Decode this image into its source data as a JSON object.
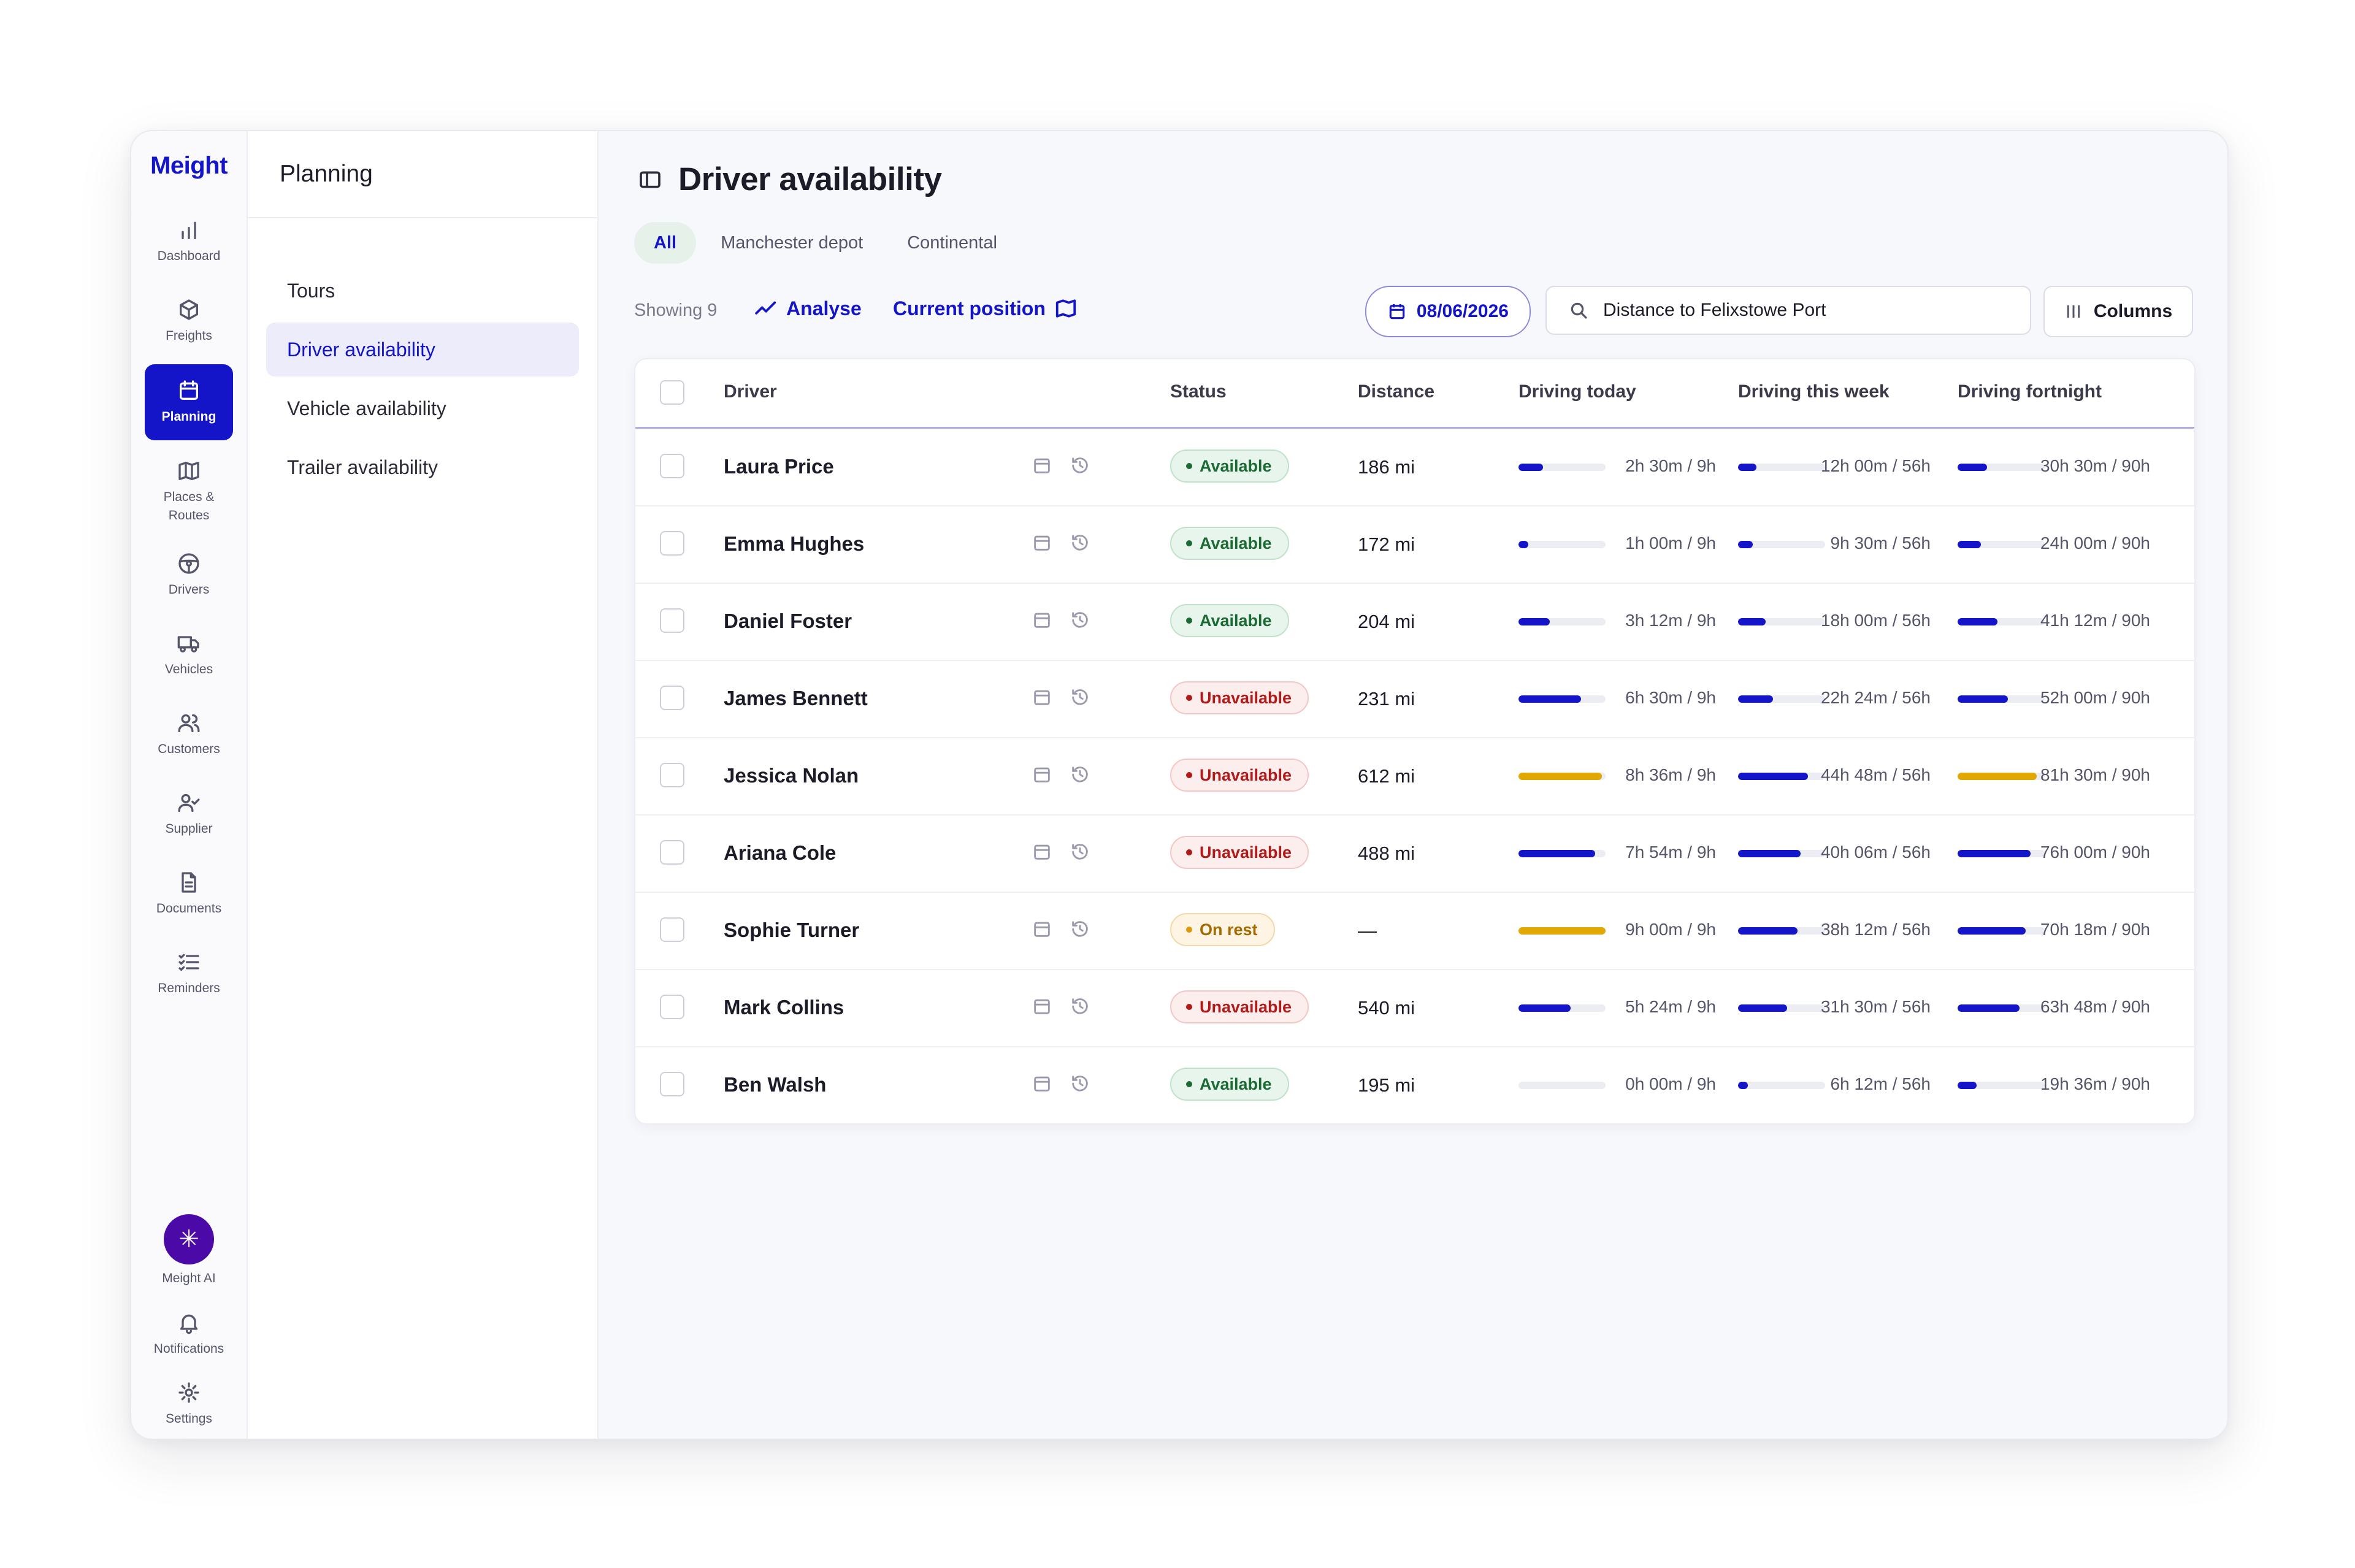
{
  "brand": "Meight",
  "rail": {
    "items": [
      {
        "label": "Dashboard",
        "icon": "bar-chart-icon"
      },
      {
        "label": "Freights",
        "icon": "box-icon"
      },
      {
        "label": "Planning",
        "icon": "calendar-icon",
        "active": true
      },
      {
        "label": "Places &\nRoutes",
        "icon": "map-icon"
      },
      {
        "label": "Drivers",
        "icon": "steering-wheel-icon"
      },
      {
        "label": "Vehicles",
        "icon": "truck-icon"
      },
      {
        "label": "Customers",
        "icon": "users-icon"
      },
      {
        "label": "Supplier",
        "icon": "user-check-icon"
      },
      {
        "label": "Documents",
        "icon": "document-icon"
      },
      {
        "label": "Reminders",
        "icon": "checklist-icon"
      }
    ],
    "bottom": {
      "ai_label": "Meight AI",
      "notifications_label": "Notifications",
      "settings_label": "Settings"
    }
  },
  "subnav": {
    "title": "Planning",
    "items": [
      {
        "label": "Tours"
      },
      {
        "label": "Driver availability",
        "active": true
      },
      {
        "label": "Vehicle availability"
      },
      {
        "label": "Trailer availability"
      }
    ]
  },
  "page": {
    "title": "Driver availability",
    "tabs": [
      "All",
      "Manchester depot",
      "Continental"
    ],
    "active_tab": "All",
    "showing": "Showing 9",
    "analyse_label": "Analyse",
    "position_label": "Current position",
    "date": "08/06/2026",
    "search_placeholder": "Distance to Felixstowe Port",
    "columns_label": "Columns"
  },
  "table": {
    "headers": {
      "driver": "Driver",
      "status": "Status",
      "distance": "Distance",
      "today": "Driving today",
      "week": "Driving this week",
      "fortnight": "Driving fortnight"
    },
    "rows": [
      {
        "driver": "Laura Price",
        "status": "Available",
        "state": "avail",
        "distance": "186 mi",
        "today": "2h 30m / 9h",
        "today_p": 0.28,
        "week": "12h 00m / 56h",
        "week_p": 0.21,
        "fort": "30h 30m / 90h",
        "fort_p": 0.34
      },
      {
        "driver": "Emma Hughes",
        "status": "Available",
        "state": "avail",
        "distance": "172 mi",
        "today": "1h 00m / 9h",
        "today_p": 0.11,
        "week": "9h 30m / 56h",
        "week_p": 0.17,
        "fort": "24h 00m / 90h",
        "fort_p": 0.27
      },
      {
        "driver": "Daniel Foster",
        "status": "Available",
        "state": "avail",
        "distance": "204 mi",
        "today": "3h 12m / 9h",
        "today_p": 0.36,
        "week": "18h 00m / 56h",
        "week_p": 0.32,
        "fort": "41h 12m / 90h",
        "fort_p": 0.46
      },
      {
        "driver": "James Bennett",
        "status": "Unavailable",
        "state": "unav",
        "distance": "231 mi",
        "today": "6h 30m / 9h",
        "today_p": 0.72,
        "week": "22h 24m / 56h",
        "week_p": 0.4,
        "fort": "52h 00m / 90h",
        "fort_p": 0.58
      },
      {
        "driver": "Jessica Nolan",
        "status": "Unavailable",
        "state": "unav",
        "distance": "612 mi",
        "today": "8h 36m / 9h",
        "today_p": 0.96,
        "today_warn": true,
        "week": "44h 48m / 56h",
        "week_p": 0.8,
        "fort": "81h 30m / 90h",
        "fort_p": 0.91,
        "fort_warn": true
      },
      {
        "driver": "Ariana Cole",
        "status": "Unavailable",
        "state": "unav",
        "distance": "488 mi",
        "today": "7h 54m / 9h",
        "today_p": 0.88,
        "week": "40h 06m / 56h",
        "week_p": 0.72,
        "fort": "76h 00m / 90h",
        "fort_p": 0.84
      },
      {
        "driver": "Sophie Turner",
        "status": "On rest",
        "state": "rest",
        "distance": "—",
        "today": "9h 00m / 9h",
        "today_p": 1.0,
        "today_warn": true,
        "week": "38h 12m / 56h",
        "week_p": 0.68,
        "fort": "70h 18m / 90h",
        "fort_p": 0.78
      },
      {
        "driver": "Mark Collins",
        "status": "Unavailable",
        "state": "unav",
        "distance": "540 mi",
        "today": "5h 24m / 9h",
        "today_p": 0.6,
        "week": "31h 30m / 56h",
        "week_p": 0.56,
        "fort": "63h 48m / 90h",
        "fort_p": 0.71
      },
      {
        "driver": "Ben Walsh",
        "status": "Available",
        "state": "avail",
        "distance": "195 mi",
        "today": "0h 00m / 9h",
        "today_p": 0.0,
        "week": "6h 12m / 56h",
        "week_p": 0.11,
        "fort": "19h 36m / 90h",
        "fort_p": 0.22
      }
    ]
  },
  "colors": {
    "accent": "#1414c8",
    "warning": "#e0a800",
    "ai": "#4b0aa8",
    "available": "#1d6b34",
    "unavailable": "#b21a1a",
    "on_rest": "#a36a00"
  }
}
